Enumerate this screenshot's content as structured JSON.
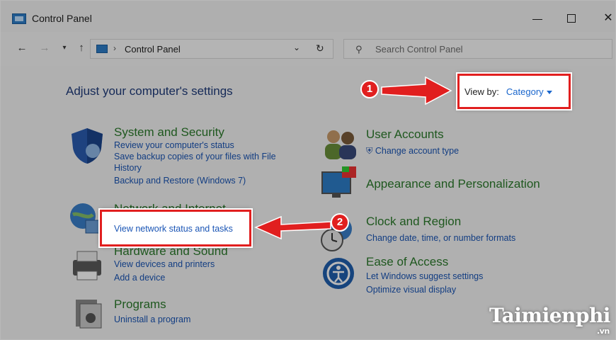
{
  "window": {
    "title": "Control Panel"
  },
  "nav": {
    "address_path": "Control Panel",
    "search_placeholder": "Search Control Panel"
  },
  "main": {
    "heading": "Adjust your computer's settings",
    "view_by_label": "View by:",
    "view_by_value": "Category",
    "categories_left": [
      {
        "title": "System and Security",
        "links": [
          "Review your computer's status",
          "Save backup copies of your files with File History",
          "Backup and Restore (Windows 7)"
        ]
      },
      {
        "title": "Network and Internet",
        "links": [
          "View network status and tasks"
        ]
      },
      {
        "title": "Hardware and Sound",
        "links": [
          "View devices and printers",
          "Add a device"
        ]
      },
      {
        "title": "Programs",
        "links": [
          "Uninstall a program"
        ]
      }
    ],
    "categories_right": [
      {
        "title": "User Accounts",
        "links": [
          "Change account type"
        ]
      },
      {
        "title": "Appearance and Personalization",
        "links": []
      },
      {
        "title": "Clock and Region",
        "links": [
          "Change date, time, or number formats"
        ]
      },
      {
        "title": "Ease of Access",
        "links": [
          "Let Windows suggest settings",
          "Optimize visual display"
        ]
      }
    ]
  },
  "annotations": {
    "step1": "1",
    "step2": "2",
    "highlight_color": "#e11f1f"
  },
  "watermark": {
    "brand": "aimienphi",
    "brand_initial": "T",
    "suffix": ".vn"
  }
}
